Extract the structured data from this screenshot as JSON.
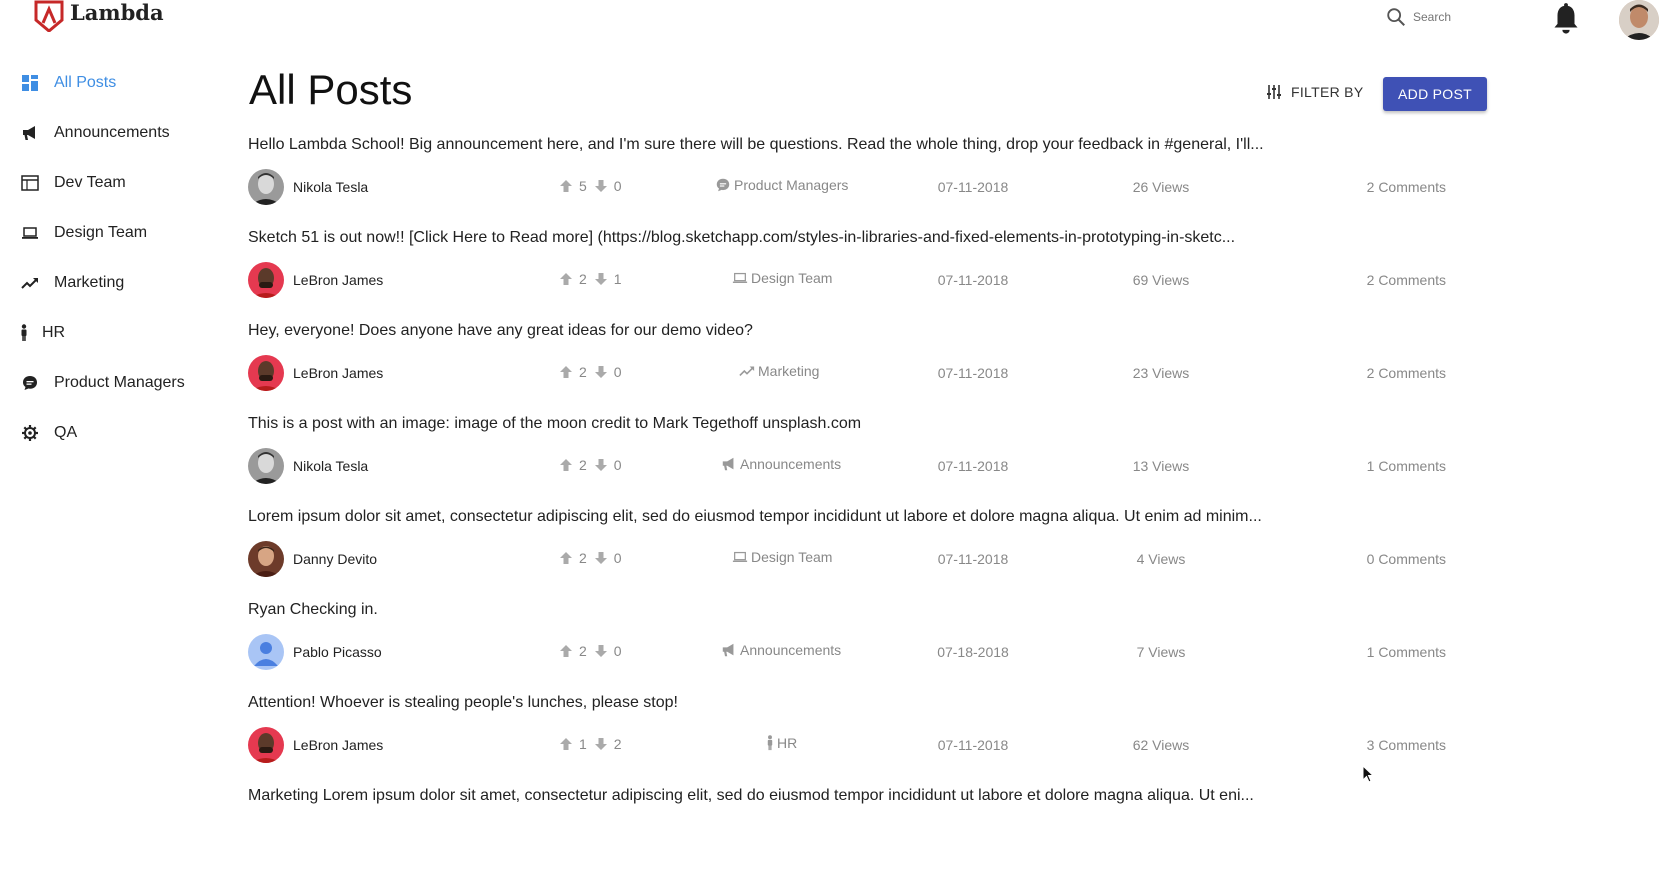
{
  "brand": {
    "name": "Lambda"
  },
  "header": {
    "search_placeholder": "Search"
  },
  "sidebar": {
    "items": [
      {
        "label": "All Posts",
        "icon": "grid-icon",
        "active": true
      },
      {
        "label": "Announcements",
        "icon": "megaphone-icon",
        "active": false
      },
      {
        "label": "Dev Team",
        "icon": "browser-window-icon",
        "active": false
      },
      {
        "label": "Design Team",
        "icon": "laptop-icon",
        "active": false
      },
      {
        "label": "Marketing",
        "icon": "trending-up-icon",
        "active": false
      },
      {
        "label": "HR",
        "icon": "person-icon",
        "active": false
      },
      {
        "label": "Product Managers",
        "icon": "chat-bubble-icon",
        "active": false
      },
      {
        "label": "QA",
        "icon": "gear-icon",
        "active": false
      }
    ]
  },
  "main": {
    "title": "All Posts",
    "filter_label": "FILTER BY",
    "add_post_label": "ADD POST"
  },
  "colors": {
    "accent": "#3f8ee3",
    "button": "#3f51b5",
    "muted": "#888888"
  },
  "posts": [
    {
      "title": "Hello Lambda School! Big announcement here, and I'm sure there will be questions. Read the whole thing, drop your feedback in #general, I'll...",
      "author": "Nikola Tesla",
      "up": "5",
      "down": "0",
      "category": "Product Managers",
      "category_icon": "chat-bubble-icon",
      "date": "07-11-2018",
      "views": "26 Views",
      "comments": "2 Comments"
    },
    {
      "title": "Sketch 51 is out now!! [Click Here to Read more] (https://blog.sketchapp.com/styles-in-libraries-and-fixed-elements-in-prototyping-in-sketc...",
      "author": "LeBron James",
      "up": "2",
      "down": "1",
      "category": "Design Team",
      "category_icon": "laptop-icon",
      "date": "07-11-2018",
      "views": "69 Views",
      "comments": "2 Comments"
    },
    {
      "title": "Hey, everyone! Does anyone have any great ideas for our demo video?",
      "author": "LeBron James",
      "up": "2",
      "down": "0",
      "category": "Marketing",
      "category_icon": "trending-up-icon",
      "date": "07-11-2018",
      "views": "23 Views",
      "comments": "2 Comments"
    },
    {
      "title": "This is a post with an image: image of the moon credit to Mark Tegethoff unsplash.com",
      "author": "Nikola Tesla",
      "up": "2",
      "down": "0",
      "category": "Announcements",
      "category_icon": "megaphone-icon",
      "date": "07-11-2018",
      "views": "13 Views",
      "comments": "1 Comments"
    },
    {
      "title": "Lorem ipsum dolor sit amet, consectetur adipiscing elit, sed do eiusmod tempor incididunt ut labore et dolore magna aliqua. Ut enim ad minim...",
      "author": "Danny Devito",
      "up": "2",
      "down": "0",
      "category": "Design Team",
      "category_icon": "laptop-icon",
      "date": "07-11-2018",
      "views": "4 Views",
      "comments": "0 Comments"
    },
    {
      "title": "Ryan Checking in.",
      "author": "Pablo Picasso",
      "up": "2",
      "down": "0",
      "category": "Announcements",
      "category_icon": "megaphone-icon",
      "date": "07-18-2018",
      "views": "7 Views",
      "comments": "1 Comments"
    },
    {
      "title": "Attention! Whoever is stealing people's lunches, please stop!",
      "author": "LeBron James",
      "up": "1",
      "down": "2",
      "category": "HR",
      "category_icon": "person-icon",
      "date": "07-11-2018",
      "views": "62 Views",
      "comments": "3 Comments"
    },
    {
      "title": "Marketing Lorem ipsum dolor sit amet, consectetur adipiscing elit, sed do eiusmod tempor incididunt ut labore et dolore magna aliqua. Ut eni...",
      "author": "",
      "up": "",
      "down": "",
      "category": "",
      "category_icon": "",
      "date": "",
      "views": "",
      "comments": ""
    }
  ]
}
